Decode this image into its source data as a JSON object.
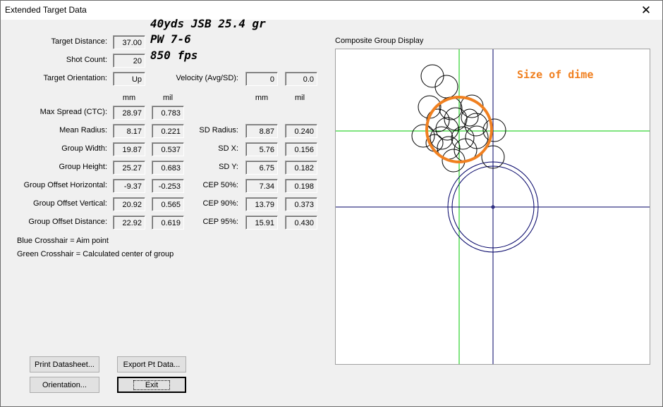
{
  "window": {
    "title": "Extended Target Data",
    "close_glyph": "✕"
  },
  "annotations": {
    "line1": "40yds JSB 25.4 gr",
    "line2": "PW 7-6",
    "line3": "850 fps"
  },
  "target": {
    "distance_label": "Target Distance:",
    "distance": "37.00",
    "shot_count_label": "Shot Count:",
    "shot_count": "20",
    "orientation_label": "Target Orientation:",
    "orientation": "Up",
    "velocity_label": "Velocity (Avg/SD):",
    "velocity_avg": "0",
    "velocity_sd": "0.0"
  },
  "units": {
    "mm": "mm",
    "mil": "mil"
  },
  "left_stats": [
    {
      "label": "Max Spread (CTC):",
      "mm": "28.97",
      "mil": "0.783"
    },
    {
      "label": "Mean Radius:",
      "mm": "8.17",
      "mil": "0.221"
    },
    {
      "label": "Group Width:",
      "mm": "19.87",
      "mil": "0.537"
    },
    {
      "label": "Group Height:",
      "mm": "25.27",
      "mil": "0.683"
    },
    {
      "label": "Group Offset Horizontal:",
      "mm": "-9.37",
      "mil": "-0.253"
    },
    {
      "label": "Group Offset Vertical:",
      "mm": "20.92",
      "mil": "0.565"
    },
    {
      "label": "Group Offset Distance:",
      "mm": "22.92",
      "mil": "0.619"
    }
  ],
  "right_stats": [
    {
      "label": "SD Radius:",
      "mm": "8.87",
      "mil": "0.240"
    },
    {
      "label": "SD X:",
      "mm": "5.76",
      "mil": "0.156"
    },
    {
      "label": "SD Y:",
      "mm": "6.75",
      "mil": "0.182"
    },
    {
      "label": "CEP 50%:",
      "mm": "7.34",
      "mil": "0.198"
    },
    {
      "label": "CEP 90%:",
      "mm": "13.79",
      "mil": "0.373"
    },
    {
      "label": "CEP 95%:",
      "mm": "15.91",
      "mil": "0.430"
    }
  ],
  "legend": {
    "blue": "Blue Crosshair = Aim point",
    "green": "Green Crosshair = Calculated center of group"
  },
  "buttons": {
    "print": "Print Datasheet...",
    "export": "Export Pt Data...",
    "orientation": "Orientation...",
    "exit": "Exit"
  },
  "composite": {
    "title": "Composite Group Display",
    "dime_label": "Size of dime",
    "colors": {
      "aim": "#000066",
      "group_center": "#00c800",
      "shots": "#000000",
      "dime": "#f08020"
    }
  }
}
